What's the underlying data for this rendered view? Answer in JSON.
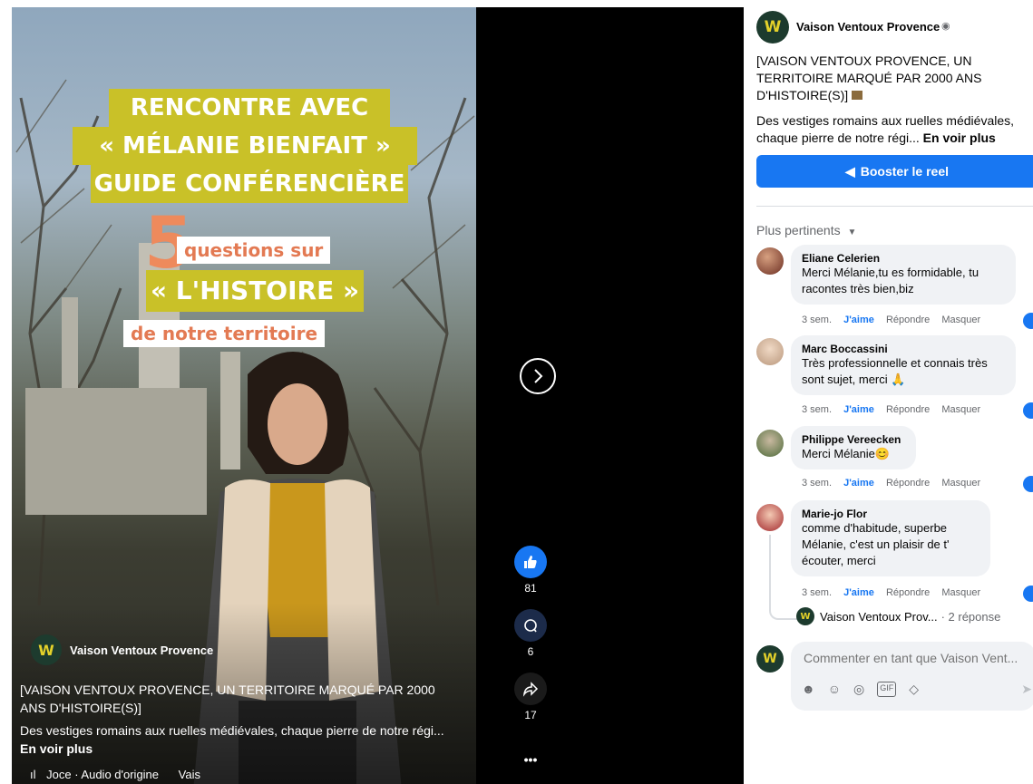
{
  "video": {
    "title_lines": [
      "RENCONTRE AVEC",
      "« MÉLANIE BIENFAIT »",
      "GUIDE CONFÉRENCIÈRE"
    ],
    "number": "5",
    "subtitle1": "questions sur",
    "subtitle2": "« L'HISTOIRE »",
    "subtitle3": "de notre territoire",
    "page_name": "Vaison Ventoux Provence",
    "caption_title": "[VAISON VENTOUX PROVENCE, UN TERRITOIRE MARQUÉ PAR 2000 ANS D'HISTOIRE(S)]",
    "caption_text": "Des vestiges romains aux ruelles médiévales, chaque pierre de notre régi...",
    "see_more": "En voir plus",
    "audio": "Joce · Audio d'origine",
    "audio_tail": "Vais"
  },
  "actions": {
    "likes": "81",
    "comments": "6",
    "shares": "17",
    "more": "•••"
  },
  "post": {
    "page_name": "Vaison Ventoux Provence",
    "title": "[VAISON VENTOUX PROVENCE, UN TERRITOIRE MARQUÉ PAR 2000 ANS D'HISTOIRE(S)]",
    "text": "Des vestiges romains aux ruelles médiévales, chaque pierre de notre régi...",
    "see_more": "En voir plus",
    "boost_label": "Booster le reel",
    "sort_label": "Plus pertinents"
  },
  "comments": [
    {
      "name": "Eliane Celerien",
      "text": "Merci Mélanie,tu es formidable, tu racontes très bien,biz",
      "time": "3 sem.",
      "like": "J'aime",
      "reply": "Répondre",
      "hide": "Masquer"
    },
    {
      "name": "Marc Boccassini",
      "text": "Très professionnelle et connais très sont sujet, merci 🙏",
      "time": "3 sem.",
      "like": "J'aime",
      "reply": "Répondre",
      "hide": "Masquer"
    },
    {
      "name": "Philippe Vereecken",
      "text": "Merci Mélanie😊",
      "time": "3 sem.",
      "like": "J'aime",
      "reply": "Répondre",
      "hide": "Masquer"
    },
    {
      "name": "Marie-jo Flor",
      "text": "comme d'habitude, superbe Mélanie, c'est un plaisir de t' écouter, merci",
      "time": "3 sem.",
      "like": "J'aime",
      "reply": "Répondre",
      "hide": "Masquer"
    }
  ],
  "replies_link": {
    "page": "Vaison Ventoux Prov...",
    "count": "· 2 réponse"
  },
  "composer": {
    "placeholder": "Commenter en tant que Vaison Vent..."
  },
  "colors": {
    "accent": "#1877f2",
    "title_yellow": "#c9c128",
    "orange": "#ee8a5c"
  }
}
